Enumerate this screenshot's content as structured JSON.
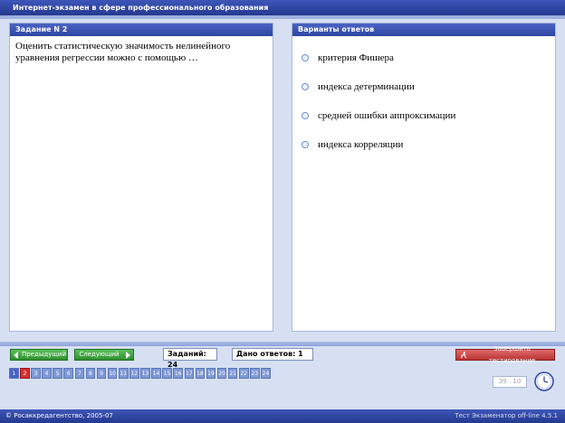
{
  "app": {
    "title": "Интернет-экзамен в сфере профессионального образования"
  },
  "question_panel": {
    "header": "Задание N 2",
    "text": "Оценить статистическую значимость нелинейного уравнения регрессии можно с помощью …"
  },
  "answers_panel": {
    "header": "Варианты ответов",
    "options": [
      "критерия Фишера",
      "индекса детерминации",
      "средней ошибки аппроксимации",
      "индекса корреляции"
    ]
  },
  "nav": {
    "prev_label": "Предыдущий",
    "next_label": "Следующий",
    "finish_label": "Завершить тестирование",
    "tasks_count": "Заданий: 24",
    "answers_given": "Дано ответов: 1"
  },
  "pages": {
    "items": [
      "1",
      "2",
      "3",
      "4",
      "5",
      "6",
      "7",
      "8",
      "9",
      "10",
      "11",
      "12",
      "13",
      "14",
      "15",
      "16",
      "17",
      "18",
      "19",
      "20",
      "21",
      "22",
      "23",
      "24"
    ],
    "current": 2
  },
  "timer": {
    "value": "39 : 10"
  },
  "status": {
    "left": "© Росаккредагентство, 2005-07",
    "right": "Тест Экзаменатор off-line 4.5.1"
  },
  "colors": {
    "accent": "#2e46a3",
    "active_page": "#d63030",
    "next_green": "#2f8f2f",
    "finish_red": "#b83434"
  }
}
